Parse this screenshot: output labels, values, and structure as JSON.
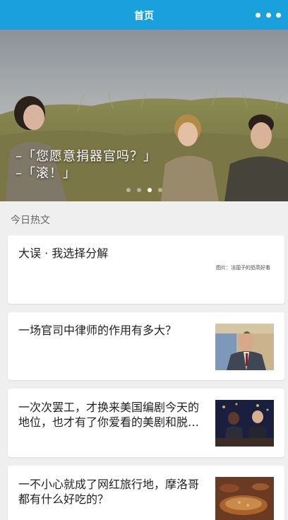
{
  "navbar": {
    "title": "首页",
    "more_icon": "more-dots-icon"
  },
  "banner": {
    "caption_line1": "–「您愿意捐器官吗？」",
    "caption_line2": "–「滚！」",
    "slide_count": 4,
    "active_slide": 2
  },
  "section": {
    "title": "今日热文"
  },
  "articles": [
    {
      "title": "大误 · 我选择分解",
      "source": "图片：法国子的恐高好看"
    },
    {
      "title": "一场官司中律师的作用有多大？"
    },
    {
      "title": "一次次罢工，才换来美国编剧今天的地位，也才有了你爱看的美剧和脱…"
    },
    {
      "title": "一不小心就成了网红旅行地，摩洛哥都有什么好吃的？"
    }
  ],
  "colors": {
    "accent": "#1aa0dc",
    "background": "#efefef"
  }
}
